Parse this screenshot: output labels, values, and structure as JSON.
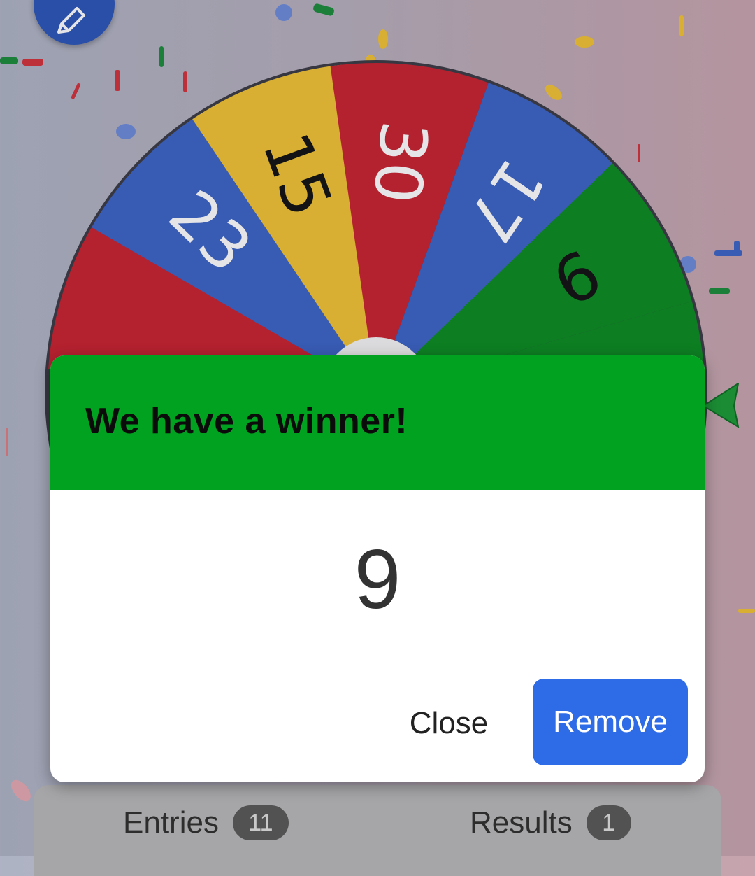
{
  "wheel": {
    "segments": [
      {
        "label": "23",
        "color": "#3b62c4",
        "text_color": "#ffffff"
      },
      {
        "label": "15",
        "color": "#f1c232",
        "text_color": "#111111"
      },
      {
        "label": "30",
        "color": "#c8202e",
        "text_color": "#ffffff"
      },
      {
        "label": "17",
        "color": "#3b62c4",
        "text_color": "#ffffff"
      },
      {
        "label": "9",
        "color": "#0a8a1f",
        "text_color": "#111111"
      }
    ]
  },
  "dialog": {
    "title": "We have a winner!",
    "winner": "9",
    "close_label": "Close",
    "remove_label": "Remove",
    "header_color": "#00a21f",
    "remove_color": "#2e6be6"
  },
  "tabs": {
    "entries_label": "Entries",
    "entries_count": "11",
    "results_label": "Results",
    "results_count": "1"
  },
  "icons": {
    "fab": "pencil-icon",
    "pointer": "wheel-pointer-icon"
  }
}
